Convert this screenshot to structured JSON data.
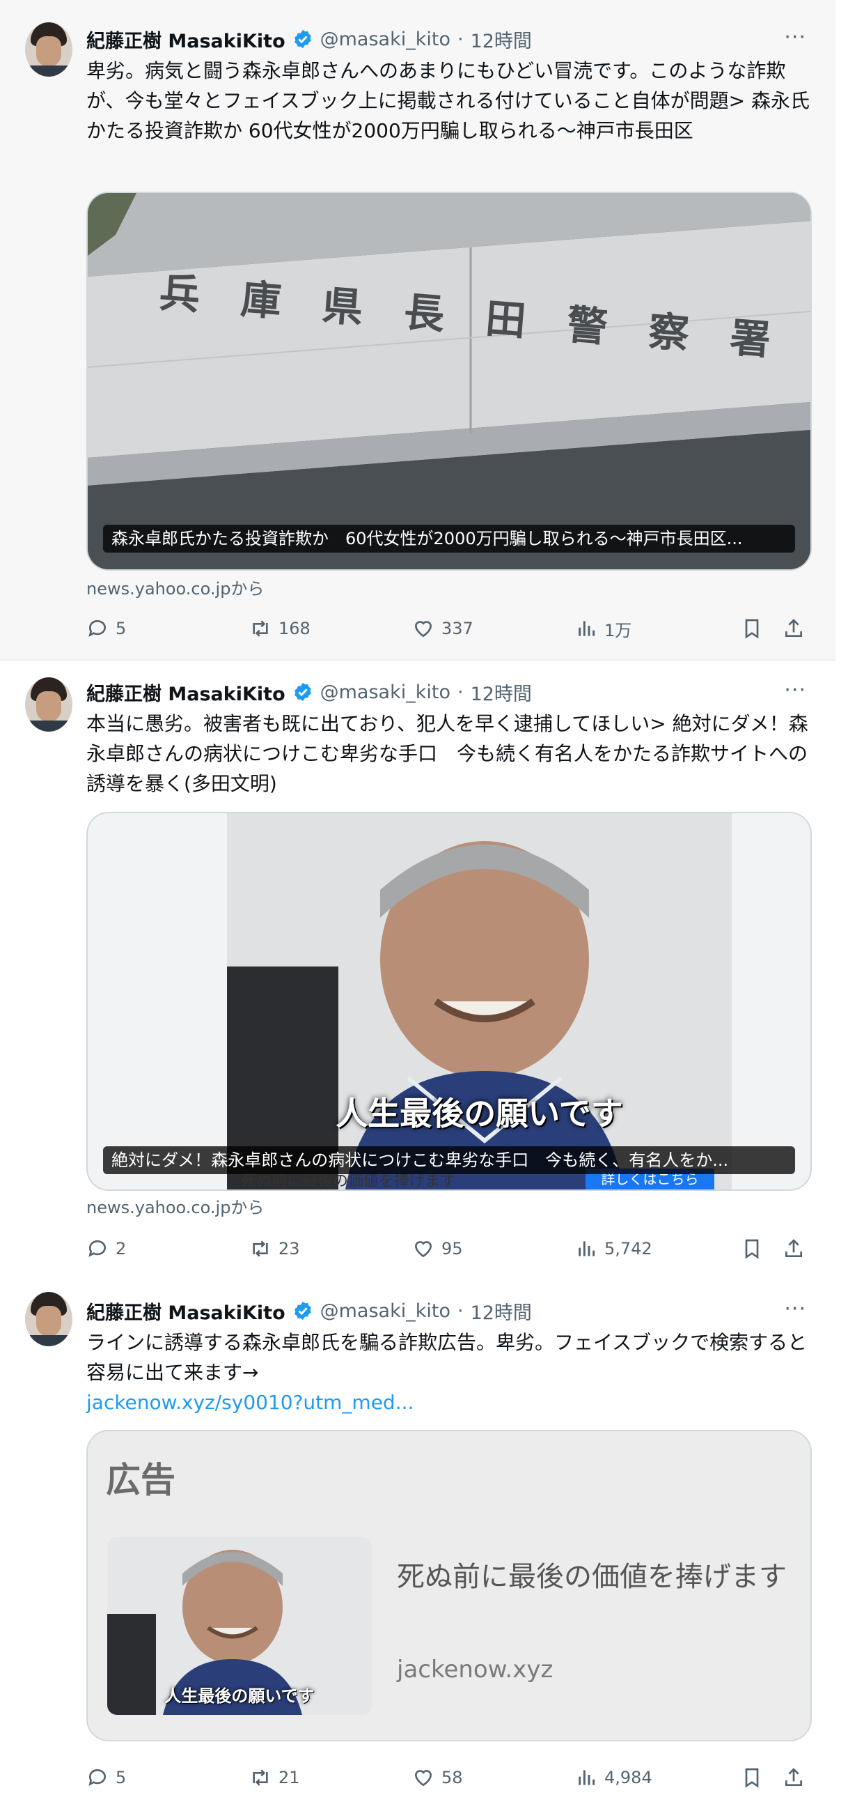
{
  "tweets": [
    {
      "name": "紀藤正樹 MasakiKito",
      "handle": "@masaki_kito",
      "dot": "·",
      "time": "12時間",
      "more": "···",
      "text": "卑劣。病気と闘う森永卓郎さんへのあまりにもひどい冒涜です。このような詐欺が、今も堂々とフェイスブック上に掲載される付けていること自体が問題> 森永氏かたる投資詐欺か 60代女性が2000万円騙し取られる～神戸市長田区",
      "card_sign": [
        "兵",
        "庫",
        "県",
        "長",
        "田",
        "警",
        "察",
        "署"
      ],
      "card_caption": "森永卓郎氏かたる投資詐欺か　60代女性が2000万円騙し取られる～神戸市長田区...",
      "source": "news.yahoo.co.jpから",
      "replies": "5",
      "retweets": "168",
      "likes": "337",
      "views": "1万"
    },
    {
      "name": "紀藤正樹 MasakiKito",
      "handle": "@masaki_kito",
      "dot": "·",
      "time": "12時間",
      "more": "···",
      "text": "本当に愚劣。被害者も既に出ており、犯人を早く逮捕してほしい> 絶対にダメ！森永卓郎さんの病状につけこむ卑劣な手口　今も続く有名人をかたる詐欺サイトへの誘導を暴く(多田文明)",
      "video_subtitle": "人生最後の願いです",
      "video_bottom_text": "死ぬ前に最後の価値を捧げます",
      "video_button": "詳しくはこちら",
      "card_caption": "絶対にダメ！森永卓郎さんの病状につけこむ卑劣な手口　今も続く、有名人をか...",
      "source": "news.yahoo.co.jpから",
      "replies": "2",
      "retweets": "23",
      "likes": "95",
      "views": "5,742"
    },
    {
      "name": "紀藤正樹 MasakiKito",
      "handle": "@masaki_kito",
      "dot": "·",
      "time": "12時間",
      "more": "···",
      "text": "ラインに誘導する森永卓郎氏を騙る詐欺広告。卑劣。フェイスブックで検索すると容易に出て来ます→",
      "link": "jackenow.xyz/sy0010?utm_med...",
      "ad_label": "広告",
      "ad_thumb_text": "人生最後の願いです",
      "ad_headline": "死ぬ前に最後の価値を捧げます",
      "ad_domain": "jackenow.xyz",
      "replies": "5",
      "retweets": "21",
      "likes": "58",
      "views": "4,984"
    }
  ],
  "colors": {
    "accent": "#1d9bf0",
    "muted": "#536471",
    "border": "#cfd9de"
  },
  "icons": [
    "verified-badge-icon",
    "reply-icon",
    "retweet-icon",
    "like-icon",
    "views-icon",
    "bookmark-icon",
    "share-icon",
    "more-icon"
  ]
}
